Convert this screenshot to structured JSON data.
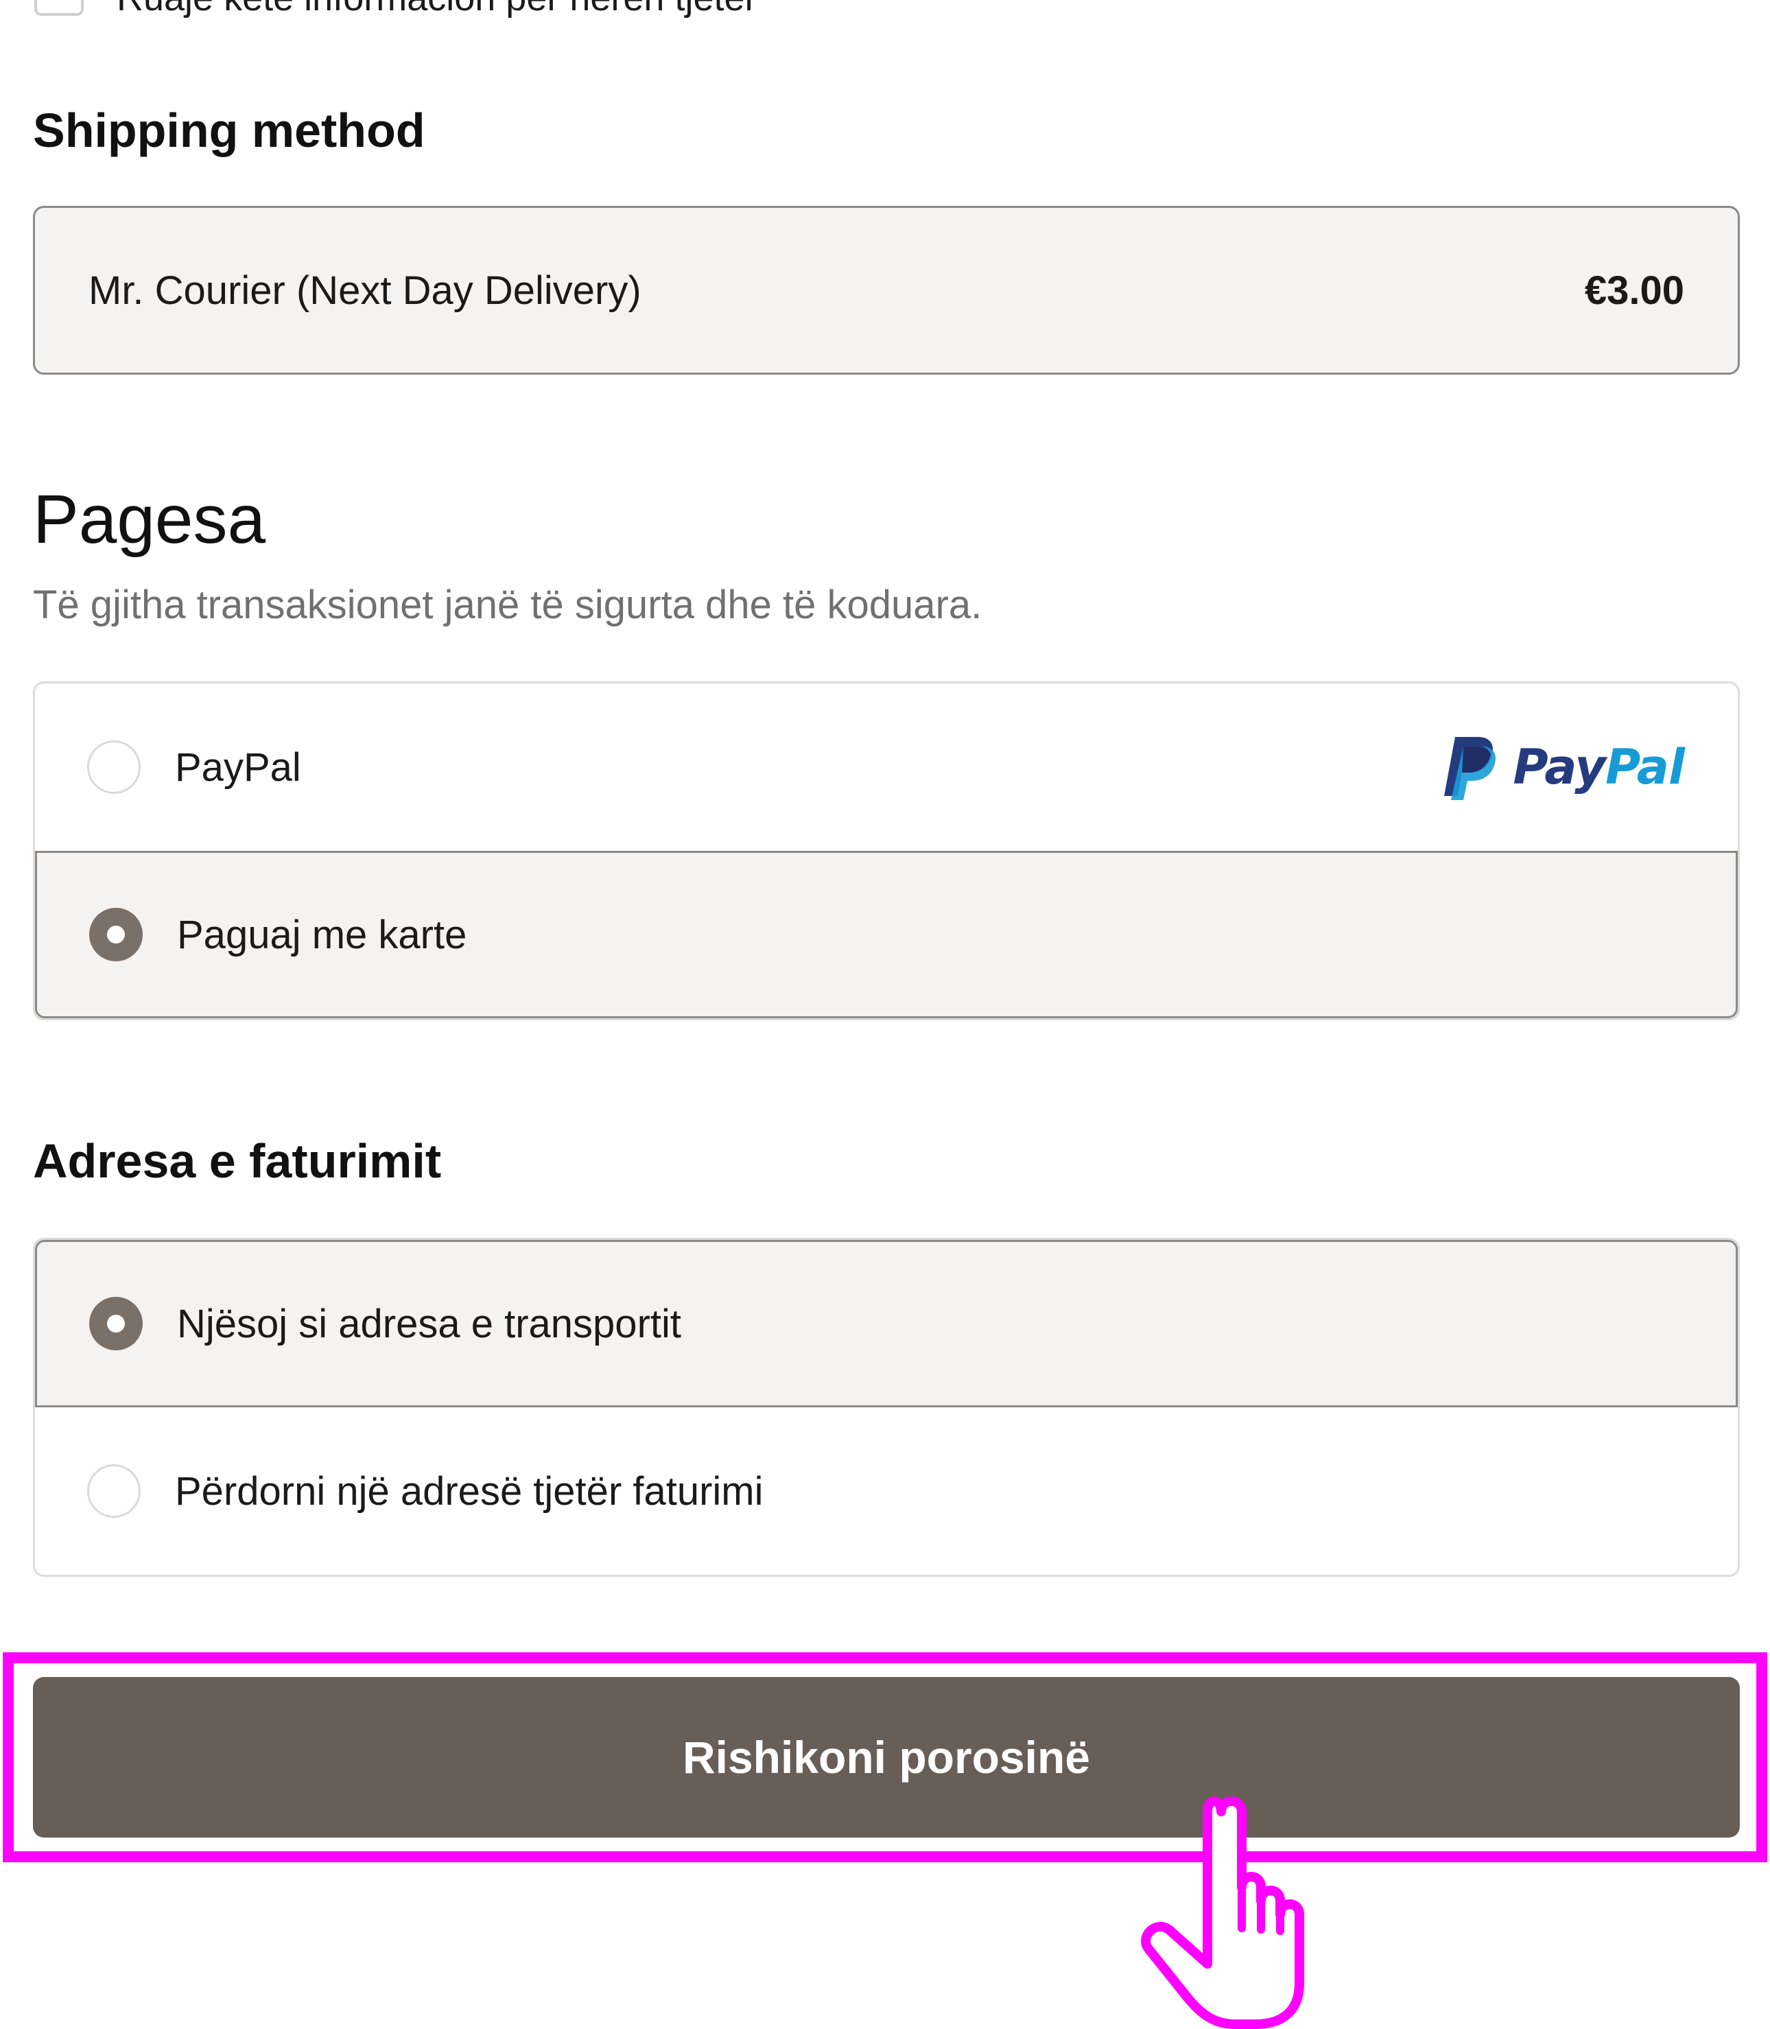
{
  "save_info": {
    "label": "Ruaje këtë informacion për herën tjetër"
  },
  "shipping": {
    "heading": "Shipping method",
    "option_name": "Mr. Courier (Next Day Delivery)",
    "option_price": "€3.00"
  },
  "payment": {
    "heading": "Pagesa",
    "subtitle": "Të gjitha transaksionet janë të sigurta dhe të koduara.",
    "options": [
      {
        "label": "PayPal",
        "selected": false,
        "logo_pay": "Pay",
        "logo_pal": "Pal"
      },
      {
        "label": "Paguaj me karte",
        "selected": true
      }
    ]
  },
  "billing": {
    "heading": "Adresa e faturimit",
    "options": [
      {
        "label": "Njësoj si adresa e transportit",
        "selected": true
      },
      {
        "label": "Përdorni një adresë tjetër faturimi",
        "selected": false
      }
    ]
  },
  "review_button": {
    "label": "Rishikoni porosinë"
  },
  "colors": {
    "button_bg": "#675e58",
    "highlight": "#ff00ff",
    "selected_bg": "#f5f3f1",
    "radio_checked": "#7a706a",
    "paypal_dark": "#253b80",
    "paypal_light": "#179bd7"
  },
  "icons": {
    "cursor": "hand-pointer-icon",
    "paypal": "paypal-logo-icon"
  }
}
